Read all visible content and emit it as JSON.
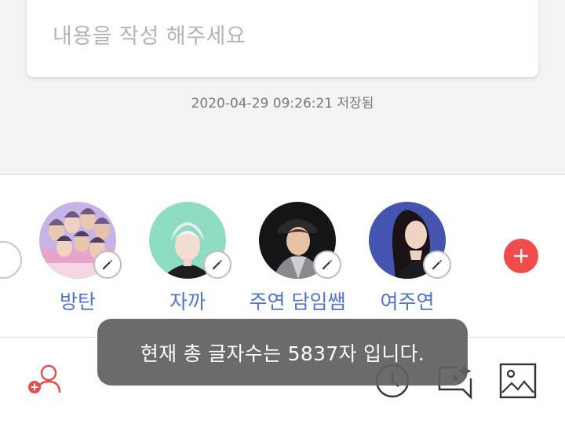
{
  "editor": {
    "placeholder": "내용을 작성 해주세요",
    "saved_status": "2020-04-29 09:26:21 저장됨"
  },
  "characters": [
    {
      "name": "방탄",
      "avatar": "group-photo"
    },
    {
      "name": "자까",
      "avatar": "mint-illustration"
    },
    {
      "name": "주연 담임쌤",
      "avatar": "portrait-dark"
    },
    {
      "name": "여주연",
      "avatar": "portrait-blue"
    }
  ],
  "toast": {
    "message": "현재 총 글자수는 5837자 입니다."
  },
  "toolbar": {
    "icons": [
      "add-user-icon",
      "clock-icon",
      "ai-chat-icon",
      "image-icon"
    ]
  },
  "colors": {
    "accent_red": "#f14b4b",
    "name_blue": "#4f74cc",
    "toast_bg": "#606060",
    "background": "#f4f4f6"
  }
}
